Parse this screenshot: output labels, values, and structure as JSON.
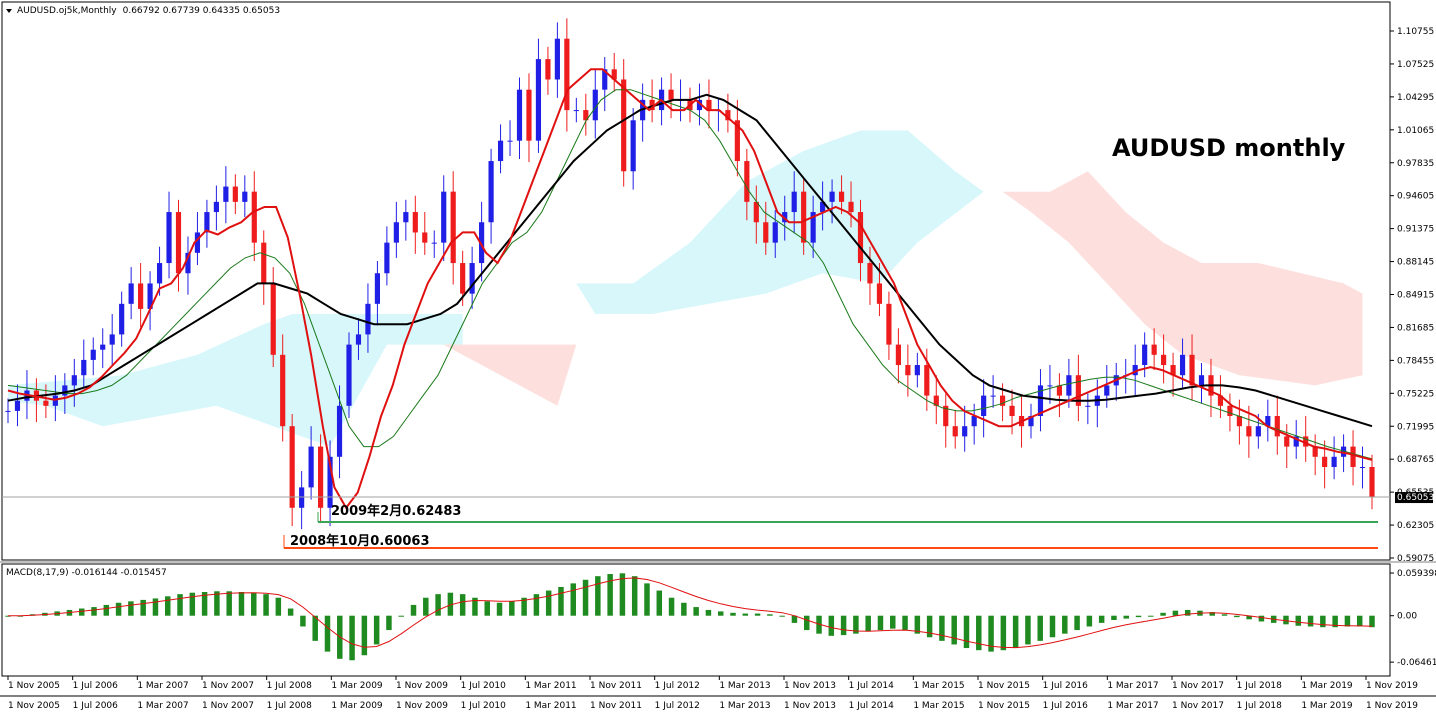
{
  "window": {
    "header": "AUDUSD.oj5k,Monthly  0.66792 0.67739 0.64335 0.65053",
    "symbol": "AUDUSD.oj5k,Monthly",
    "ohlc": "0.66792 0.67739 0.64335 0.65053"
  },
  "colors": {
    "bull": "#1f1fe6",
    "bear": "#ee1c1c",
    "ma_fast": "#e01010",
    "ma_mid": "#1a7a1a",
    "ma_slow": "#000000",
    "cloud_up": "#d7f7fb",
    "cloud_down": "#fde0de",
    "macd_hist": "#1f8a1f",
    "macd_signal": "#e01010",
    "green_level": "#3aa655",
    "orange_level": "#ff4a12"
  },
  "chart_data": [
    {
      "type": "candlestick",
      "title": "AUDUSD monthly",
      "timeframe": "Monthly",
      "ylim": [
        0.59,
        1.11
      ],
      "yticks": [
        "1.10755",
        "1.07525",
        "1.04295",
        "1.01065",
        "0.97835",
        "0.94605",
        "0.91375",
        "0.88145",
        "0.84915",
        "0.81685",
        "0.78455",
        "0.75225",
        "0.71995",
        "0.68765",
        "0.65535",
        "0.62305",
        "0.59075"
      ],
      "current_price": "0.65053",
      "xticks": [
        "1 Nov 2005",
        "1 Jul 2006",
        "1 Mar 2007",
        "1 Nov 2007",
        "1 Jul 2008",
        "1 Mar 2009",
        "1 Nov 2009",
        "1 Jul 2010",
        "1 Mar 2011",
        "1 Nov 2011",
        "1 Jul 2012",
        "1 Mar 2013",
        "1 Nov 2013",
        "1 Jul 2014",
        "1 Mar 2015",
        "1 Nov 2015",
        "1 Jul 2016",
        "1 Mar 2017",
        "1 Nov 2017",
        "1 Jul 2018",
        "1 Mar 2019",
        "1 Nov 2019"
      ],
      "xticks_row2": [
        "1 Nov 2005",
        "1 Jul 2006",
        "1 Mar 2007",
        "1 Nov 2007",
        "1 Jul 2008",
        "1 Mar 2009",
        "1 Nov 2009",
        "1 Jul 2010",
        "1 Mar 2011",
        "1 Nov 2011",
        "1 Jul 2012",
        "1 Mar 2013",
        "1 Nov 2013",
        "1 Jul 2014",
        "1 Mar 2015",
        "1 Nov 2015",
        "1 Jul 2016",
        "1 Mar 2017",
        "1 Nov 2017",
        "1 Jul 2018",
        "1 Mar 2019",
        "1 Nov 2019"
      ],
      "close_path": [
        0.735,
        0.745,
        0.755,
        0.745,
        0.74,
        0.75,
        0.76,
        0.77,
        0.785,
        0.795,
        0.8,
        0.81,
        0.84,
        0.86,
        0.835,
        0.86,
        0.88,
        0.93,
        0.87,
        0.89,
        0.91,
        0.93,
        0.94,
        0.955,
        0.94,
        0.95,
        0.9,
        0.86,
        0.79,
        0.72,
        0.64,
        0.66,
        0.7,
        0.64,
        0.69,
        0.74,
        0.8,
        0.81,
        0.84,
        0.87,
        0.9,
        0.92,
        0.93,
        0.91,
        0.9,
        0.9,
        0.95,
        0.88,
        0.85,
        0.88,
        0.92,
        0.98,
        1.0,
        1.0,
        1.05,
        1.0,
        1.08,
        1.06,
        1.1,
        1.03,
        1.03,
        1.02,
        1.05,
        1.07,
        1.06,
        0.97,
        1.02,
        1.04,
        1.03,
        1.05,
        1.04,
        1.04,
        1.03,
        1.04,
        1.03,
        1.03,
        1.02,
        0.98,
        0.94,
        0.92,
        0.9,
        0.92,
        0.93,
        0.95,
        0.9,
        0.93,
        0.94,
        0.95,
        0.94,
        0.93,
        0.88,
        0.86,
        0.84,
        0.8,
        0.78,
        0.77,
        0.78,
        0.75,
        0.74,
        0.72,
        0.71,
        0.72,
        0.73,
        0.75,
        0.75,
        0.74,
        0.73,
        0.72,
        0.73,
        0.76,
        0.76,
        0.75,
        0.77,
        0.74,
        0.74,
        0.75,
        0.76,
        0.77,
        0.77,
        0.78,
        0.8,
        0.79,
        0.78,
        0.77,
        0.79,
        0.76,
        0.77,
        0.75,
        0.74,
        0.73,
        0.72,
        0.71,
        0.72,
        0.73,
        0.71,
        0.7,
        0.71,
        0.7,
        0.69,
        0.68,
        0.69,
        0.7,
        0.68,
        0.68,
        0.65053
      ],
      "ma_fast": [
        0.755,
        0.752,
        0.75,
        0.748,
        0.746,
        0.748,
        0.752,
        0.758,
        0.768,
        0.78,
        0.792,
        0.806,
        0.83,
        0.855,
        0.86,
        0.875,
        0.9,
        0.912,
        0.908,
        0.915,
        0.92,
        0.93,
        0.935,
        0.935,
        0.905,
        0.85,
        0.79,
        0.72,
        0.66,
        0.64,
        0.655,
        0.69,
        0.73,
        0.76,
        0.8,
        0.83,
        0.86,
        0.88,
        0.9,
        0.91,
        0.91,
        0.89,
        0.88,
        0.9,
        0.93,
        0.96,
        0.99,
        1.02,
        1.05,
        1.06,
        1.07,
        1.07,
        1.06,
        1.05,
        1.04,
        1.03,
        1.04,
        1.03,
        1.03,
        1.04,
        1.03,
        1.03,
        1.02,
        1.01,
        0.99,
        0.96,
        0.93,
        0.92,
        0.92,
        0.925,
        0.93,
        0.935,
        0.93,
        0.92,
        0.9,
        0.88,
        0.86,
        0.83,
        0.8,
        0.78,
        0.76,
        0.745,
        0.735,
        0.73,
        0.725,
        0.72,
        0.72,
        0.725,
        0.73,
        0.735,
        0.74,
        0.745,
        0.75,
        0.755,
        0.76,
        0.765,
        0.77,
        0.775,
        0.778,
        0.775,
        0.77,
        0.765,
        0.76,
        0.755,
        0.75,
        0.74,
        0.735,
        0.73,
        0.72,
        0.715,
        0.71,
        0.705,
        0.7,
        0.698,
        0.695,
        0.693,
        0.69,
        0.687
      ],
      "ma_mid": [
        0.76,
        0.758,
        0.756,
        0.754,
        0.752,
        0.752,
        0.755,
        0.76,
        0.77,
        0.785,
        0.8,
        0.815,
        0.83,
        0.845,
        0.86,
        0.875,
        0.885,
        0.89,
        0.885,
        0.87,
        0.84,
        0.8,
        0.76,
        0.72,
        0.7,
        0.7,
        0.71,
        0.73,
        0.75,
        0.77,
        0.8,
        0.83,
        0.86,
        0.88,
        0.9,
        0.91,
        0.93,
        0.96,
        0.99,
        1.02,
        1.04,
        1.05,
        1.05,
        1.045,
        1.04,
        1.035,
        1.03,
        1.02,
        1.0,
        0.975,
        0.95,
        0.93,
        0.92,
        0.91,
        0.9,
        0.88,
        0.85,
        0.82,
        0.8,
        0.78,
        0.765,
        0.755,
        0.745,
        0.738,
        0.735,
        0.735,
        0.738,
        0.742,
        0.748,
        0.752,
        0.756,
        0.76,
        0.763,
        0.766,
        0.768,
        0.768,
        0.765,
        0.76,
        0.755,
        0.75,
        0.745,
        0.74,
        0.735,
        0.73,
        0.725,
        0.72,
        0.715,
        0.71,
        0.705,
        0.7,
        0.696,
        0.692,
        0.688
      ],
      "ma_slow": [
        0.745,
        0.748,
        0.75,
        0.752,
        0.755,
        0.76,
        0.77,
        0.78,
        0.79,
        0.8,
        0.81,
        0.82,
        0.83,
        0.84,
        0.85,
        0.86,
        0.86,
        0.855,
        0.85,
        0.84,
        0.83,
        0.825,
        0.82,
        0.82,
        0.82,
        0.825,
        0.83,
        0.84,
        0.86,
        0.88,
        0.9,
        0.92,
        0.94,
        0.96,
        0.98,
        0.995,
        1.01,
        1.02,
        1.03,
        1.035,
        1.04,
        1.04,
        1.045,
        1.04,
        1.03,
        1.02,
        1.0,
        0.98,
        0.96,
        0.94,
        0.92,
        0.9,
        0.88,
        0.86,
        0.84,
        0.82,
        0.8,
        0.785,
        0.77,
        0.76,
        0.755,
        0.75,
        0.748,
        0.746,
        0.745,
        0.745,
        0.746,
        0.748,
        0.75,
        0.752,
        0.755,
        0.758,
        0.76,
        0.76,
        0.758,
        0.755,
        0.75,
        0.745,
        0.74,
        0.735,
        0.73,
        0.725,
        0.72
      ],
      "annotations": [
        {
          "label": "2009年2月0.62483",
          "price": 0.62483,
          "color": "green"
        },
        {
          "label": "2008年10月0.60063",
          "price": 0.60063,
          "color": "orange"
        }
      ],
      "ichimoku_cloud": "Kumo present (light cyan above 2009-2014 prices, light pink 2015-2020)"
    },
    {
      "type": "histogram",
      "title": "MACD(8,17,9) -0.016144 -0.015457",
      "name": "MACD(8,17,9)",
      "values_text": "-0.016144 -0.015457",
      "yticks": [
        "0.059398",
        "0.00",
        "-0.064619"
      ],
      "ylim": [
        -0.07,
        0.065
      ],
      "hist_profile": [
        0.0,
        0.0,
        0.002,
        0.004,
        0.006,
        0.008,
        0.01,
        0.012,
        0.015,
        0.018,
        0.02,
        0.022,
        0.024,
        0.027,
        0.03,
        0.032,
        0.033,
        0.034,
        0.034,
        0.033,
        0.032,
        0.03,
        0.025,
        0.01,
        -0.015,
        -0.035,
        -0.05,
        -0.06,
        -0.062,
        -0.055,
        -0.04,
        -0.02,
        0.0,
        0.015,
        0.025,
        0.03,
        0.032,
        0.03,
        0.025,
        0.02,
        0.018,
        0.02,
        0.025,
        0.03,
        0.035,
        0.04,
        0.045,
        0.05,
        0.055,
        0.058,
        0.059,
        0.055,
        0.045,
        0.035,
        0.025,
        0.018,
        0.012,
        0.008,
        0.006,
        0.004,
        0.003,
        0.003,
        0.002,
        0.0,
        -0.01,
        -0.02,
        -0.025,
        -0.028,
        -0.027,
        -0.025,
        -0.022,
        -0.02,
        -0.018,
        -0.02,
        -0.025,
        -0.03,
        -0.035,
        -0.04,
        -0.045,
        -0.048,
        -0.05,
        -0.048,
        -0.045,
        -0.04,
        -0.035,
        -0.03,
        -0.025,
        -0.02,
        -0.015,
        -0.01,
        -0.006,
        -0.004,
        -0.002,
        0.0,
        0.004,
        0.007,
        0.008,
        0.007,
        0.005,
        0.002,
        -0.002,
        -0.005,
        -0.008,
        -0.01,
        -0.012,
        -0.014,
        -0.015,
        -0.016,
        -0.016,
        -0.015,
        -0.015,
        -0.016
      ]
    }
  ]
}
